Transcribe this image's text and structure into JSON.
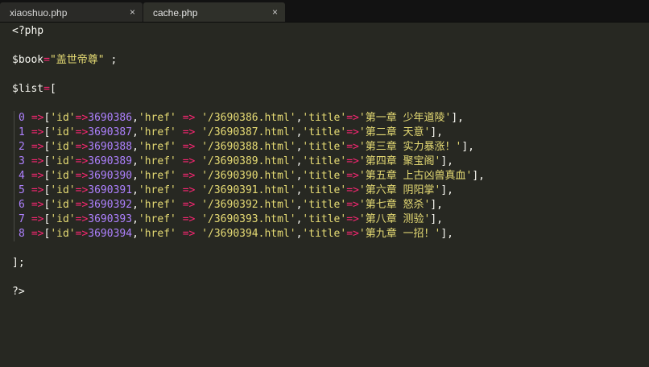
{
  "tabs": [
    {
      "label": "xiaoshuo.php",
      "close": "×",
      "active": false
    },
    {
      "label": "cache.php",
      "close": "×",
      "active": true
    }
  ],
  "code": {
    "open_tag": "<?php",
    "book_line": {
      "var": "$book",
      "op": "=",
      "value": "\"盖世帝尊\"",
      "end": " ;"
    },
    "list_line": {
      "var": "$list",
      "op": "=",
      "bracket": "["
    },
    "rows": [
      {
        "n": "0",
        "id": "3690386",
        "href": "'/3690386.html'",
        "title": "'第一章 少年道陵'"
      },
      {
        "n": "1",
        "id": "3690387",
        "href": "'/3690387.html'",
        "title": "'第二章 天意'"
      },
      {
        "n": "2",
        "id": "3690388",
        "href": "'/3690388.html'",
        "title": "'第三章 实力暴涨！'"
      },
      {
        "n": "3",
        "id": "3690389",
        "href": "'/3690389.html'",
        "title": "'第四章 聚宝阁'"
      },
      {
        "n": "4",
        "id": "3690390",
        "href": "'/3690390.html'",
        "title": "'第五章 上古凶兽真血'"
      },
      {
        "n": "5",
        "id": "3690391",
        "href": "'/3690391.html'",
        "title": "'第六章 阴阳掌'"
      },
      {
        "n": "6",
        "id": "3690392",
        "href": "'/3690392.html'",
        "title": "'第七章 怒杀'"
      },
      {
        "n": "7",
        "id": "3690393",
        "href": "'/3690393.html'",
        "title": "'第八章 测验'"
      },
      {
        "n": "8",
        "id": "3690394",
        "href": "'/3690394.html'",
        "title": "'第九章 一招！'"
      }
    ],
    "row_tokens": {
      "arrow": "=>",
      "spaced_arrow": " => ",
      "open": "[",
      "close_comma": "],",
      "id_key": "'id'",
      "href_key": "'href'",
      "title_key": "'title'",
      "comma": ","
    },
    "close_line": "];",
    "close_tag": "?>"
  },
  "colors": {
    "background": "#272822",
    "text": "#f8f8f2",
    "number": "#ae81ff",
    "operator": "#f92672",
    "string": "#e6db74"
  }
}
